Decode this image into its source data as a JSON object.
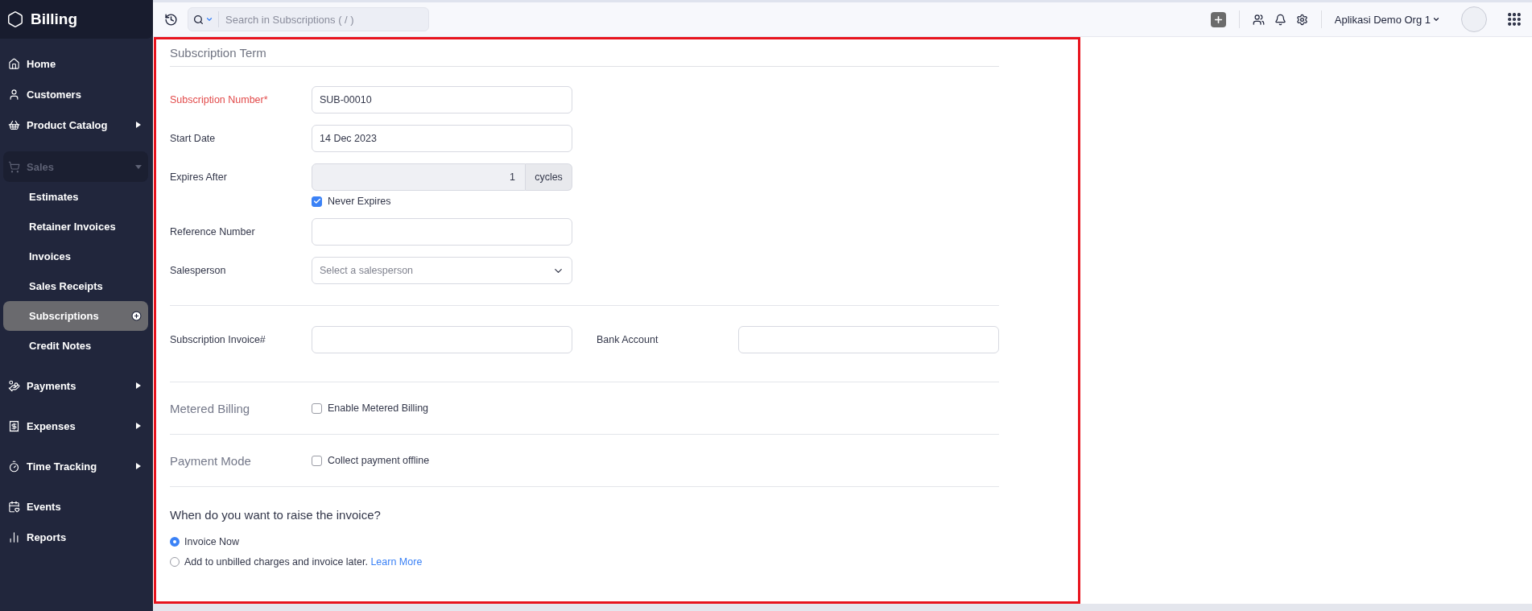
{
  "app": {
    "name": "Billing"
  },
  "sidebar": {
    "items": [
      {
        "kind": "link",
        "label": "Home"
      },
      {
        "kind": "link",
        "label": "Customers"
      },
      {
        "kind": "menu",
        "label": "Product Catalog",
        "expanded": false
      },
      {
        "kind": "group",
        "label": "Sales",
        "expanded": true,
        "children": [
          {
            "label": "Estimates",
            "selected": false
          },
          {
            "label": "Retainer Invoices",
            "selected": false
          },
          {
            "label": "Invoices",
            "selected": false
          },
          {
            "label": "Sales Receipts",
            "selected": false
          },
          {
            "label": "Subscriptions",
            "selected": true
          },
          {
            "label": "Credit Notes",
            "selected": false
          }
        ]
      },
      {
        "kind": "menu",
        "label": "Payments",
        "expanded": false
      },
      {
        "kind": "menu",
        "label": "Expenses",
        "expanded": false
      },
      {
        "kind": "menu",
        "label": "Time Tracking",
        "expanded": false
      },
      {
        "kind": "link",
        "label": "Events"
      },
      {
        "kind": "link",
        "label": "Reports"
      }
    ]
  },
  "topbar": {
    "search": {
      "placeholder": "Search in Subscriptions ( / )"
    },
    "org": "Aplikasi Demo Org 1"
  },
  "form": {
    "section_title": "Subscription Term",
    "fields": [
      {
        "kind": "text",
        "label": "Subscription Number*",
        "required": true,
        "value": "SUB-00010"
      },
      {
        "kind": "text",
        "label": "Start Date",
        "required": false,
        "value": "14 Dec 2023"
      },
      {
        "kind": "addon",
        "label": "Expires After",
        "required": false,
        "value": "1",
        "addon": "cycles",
        "disabled": true,
        "option": {
          "label": "Never Expires",
          "checked": true
        }
      },
      {
        "kind": "text",
        "label": "Reference Number",
        "required": false
      },
      {
        "kind": "select",
        "label": "Salesperson",
        "required": false,
        "placeholder": "Select a salesperson"
      }
    ],
    "pair": [
      {
        "label": "Subscription Invoice#"
      },
      {
        "label": "Bank Account"
      }
    ],
    "options": [
      {
        "title": "Metered Billing",
        "label": "Enable Metered Billing",
        "checked": false
      },
      {
        "title": "Payment Mode",
        "label": "Collect payment offline",
        "checked": false
      }
    ],
    "question": "When do you want to raise the invoice?",
    "radios": [
      {
        "label": "Invoice Now",
        "selected": true
      },
      {
        "label": "Add to unbilled charges and invoice later.",
        "link": "Learn More",
        "selected": false
      }
    ]
  }
}
